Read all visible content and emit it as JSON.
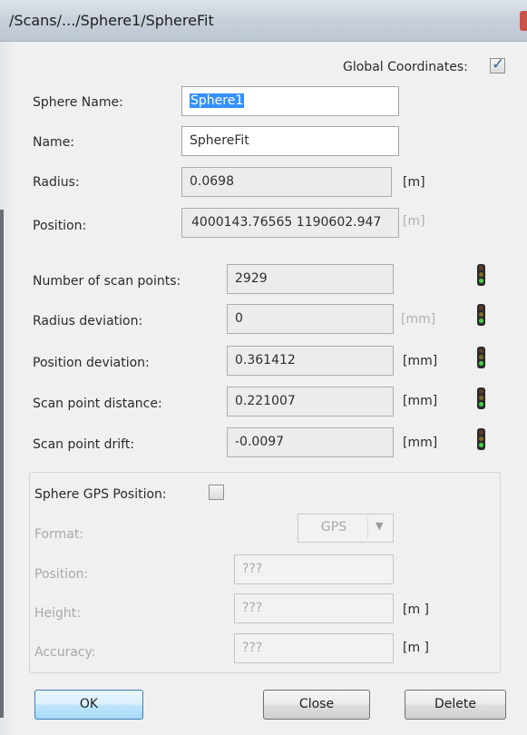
{
  "window": {
    "title": "/Scans/.../Sphere1/SphereFit"
  },
  "global_coordinates": {
    "label": "Global Coordinates:",
    "checked": true,
    "check_glyph": "✓"
  },
  "fields": {
    "sphere_name": {
      "label": "Sphere Name:",
      "value": "Sphere1"
    },
    "name": {
      "label": "Name:",
      "value": "SphereFit"
    },
    "radius": {
      "label": "Radius:",
      "value": "0.0698",
      "unit": "[m]"
    },
    "position": {
      "label": "Position:",
      "value": "4000143.76565 1190602.947",
      "unit": "[m]"
    }
  },
  "stats": [
    {
      "label": "Number of scan points:",
      "value": "2929",
      "unit": "",
      "status": "green"
    },
    {
      "label": "Radius deviation:",
      "value": "0",
      "unit": "[mm]",
      "status": "green"
    },
    {
      "label": "Position deviation:",
      "value": "0.361412",
      "unit": "[mm]",
      "status": "green"
    },
    {
      "label": "Scan point distance:",
      "value": "0.221007",
      "unit": "[mm]",
      "status": "green"
    },
    {
      "label": "Scan point drift:",
      "value": "-0.0097",
      "unit": "[mm]",
      "status": "green"
    }
  ],
  "gps": {
    "label": "Sphere GPS Position:",
    "checked": false,
    "format": {
      "label": "Format:",
      "value": "GPS"
    },
    "position": {
      "label": "Position:",
      "value": "???"
    },
    "height": {
      "label": "Height:",
      "value": "???",
      "unit": "[m ]"
    },
    "accuracy": {
      "label": "Accuracy:",
      "value": "???",
      "unit": "[m ]"
    }
  },
  "buttons": {
    "ok": "OK",
    "close": "Close",
    "delete": "Delete"
  },
  "icons": {
    "status_light": "traffic-light-icon",
    "dropdown": "chevron-down-icon",
    "checkbox": "checkbox-icon"
  },
  "colors": {
    "status_green": "#49d24a",
    "selection": "#3390ff",
    "default_button": "#a7d9f5"
  }
}
